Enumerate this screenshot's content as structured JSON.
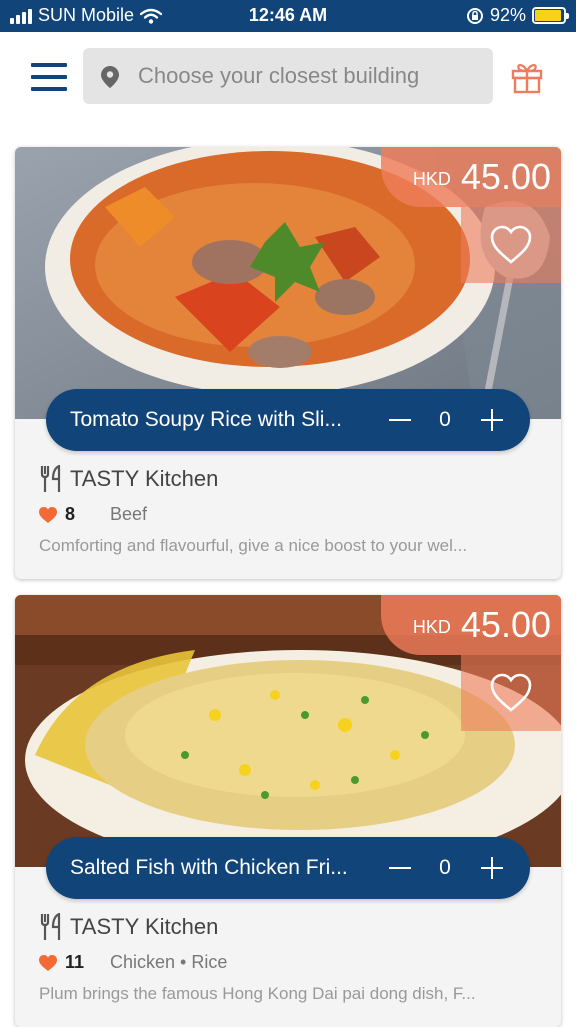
{
  "status_bar": {
    "carrier": "SUN Mobile",
    "time": "12:46 AM",
    "battery": "92%",
    "battery_level": 0.92,
    "icons": [
      "signal-icon",
      "wifi-icon",
      "rotation-lock-icon",
      "battery-icon"
    ]
  },
  "header": {
    "menu_icon": "menu-icon",
    "location_icon": "location-pin-icon",
    "search_placeholder": "Choose your closest building",
    "gift_icon": "gift-icon"
  },
  "colors": {
    "brand": "#11457a",
    "accent": "#ef7c5a",
    "heart": "#f46a36",
    "search_bg": "#e4e4e4"
  },
  "dishes": [
    {
      "currency": "HKD",
      "price": "45.00",
      "name": "Tomato Soupy Rice with Sli...",
      "quantity": "0",
      "kitchen": "TASTY Kitchen",
      "likes": "8",
      "tags": "Beef",
      "description": "Comforting and flavourful, give a nice boost to your wel..."
    },
    {
      "currency": "HKD",
      "price": "45.00",
      "name": "Salted Fish with Chicken Fri...",
      "quantity": "0",
      "kitchen": "TASTY Kitchen",
      "likes": "11",
      "tags": "Chicken • Rice",
      "description": "Plum brings the famous Hong Kong Dai pai dong dish, F..."
    }
  ]
}
